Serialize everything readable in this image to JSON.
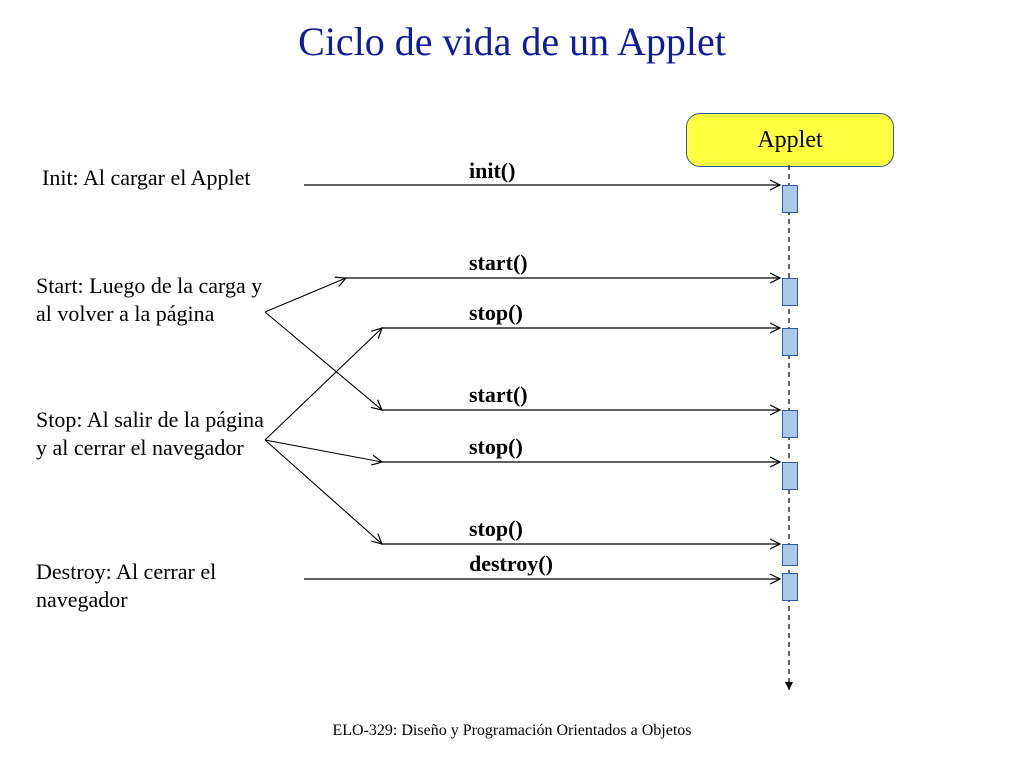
{
  "title": "Ciclo de vida de un Applet",
  "footer": "ELO-329: Diseño y Programación Orientados a Objetos",
  "applet_label": "Applet",
  "descriptions": {
    "init": "Init: Al cargar el Applet",
    "start": "Start: Luego de la carga y al volver a la página",
    "stop": "Stop: Al salir de la página y al cerrar el navegador",
    "destroy": "Destroy: Al cerrar el navegador"
  },
  "messages": {
    "m1": "init()",
    "m2": "start()",
    "m3": "stop()",
    "m4": "start()",
    "m5": "stop()",
    "m6": "stop()",
    "m7": "destroy()"
  },
  "colors": {
    "title": "#0d1c9d",
    "applet_fill": "#fdff3f",
    "applet_border": "#2e5aa0",
    "activation_fill": "#aac9e6"
  }
}
